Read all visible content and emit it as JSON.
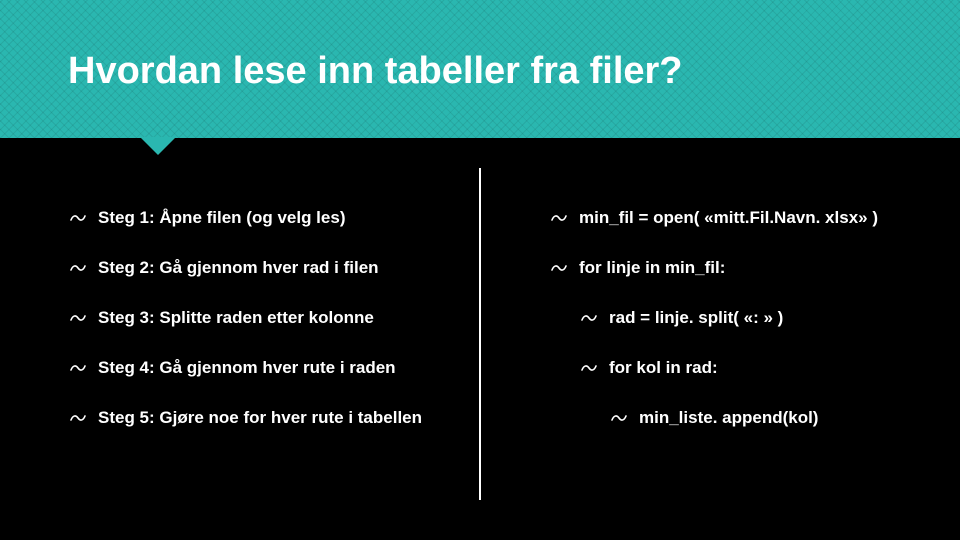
{
  "title": "Hvordan lese inn tabeller fra filer?",
  "left": {
    "items": [
      "Steg 1: Åpne filen (og velg les)",
      "Steg 2: Gå gjennom hver rad i filen",
      "Steg 3: Splitte raden etter kolonne",
      "Steg 4: Gå gjennom hver rute i raden",
      "Steg 5: Gjøre noe for hver rute i tabellen"
    ]
  },
  "right": {
    "items": [
      {
        "text": "min_fil = open( «mitt.Fil.Navn. xlsx» )",
        "indent": 0
      },
      {
        "text": "for linje in min_fil:",
        "indent": 0
      },
      {
        "text": "rad = linje. split( «: » )",
        "indent": 1
      },
      {
        "text": "for kol in rad:",
        "indent": 1
      },
      {
        "text": "min_liste. append(kol)",
        "indent": 2
      }
    ]
  }
}
